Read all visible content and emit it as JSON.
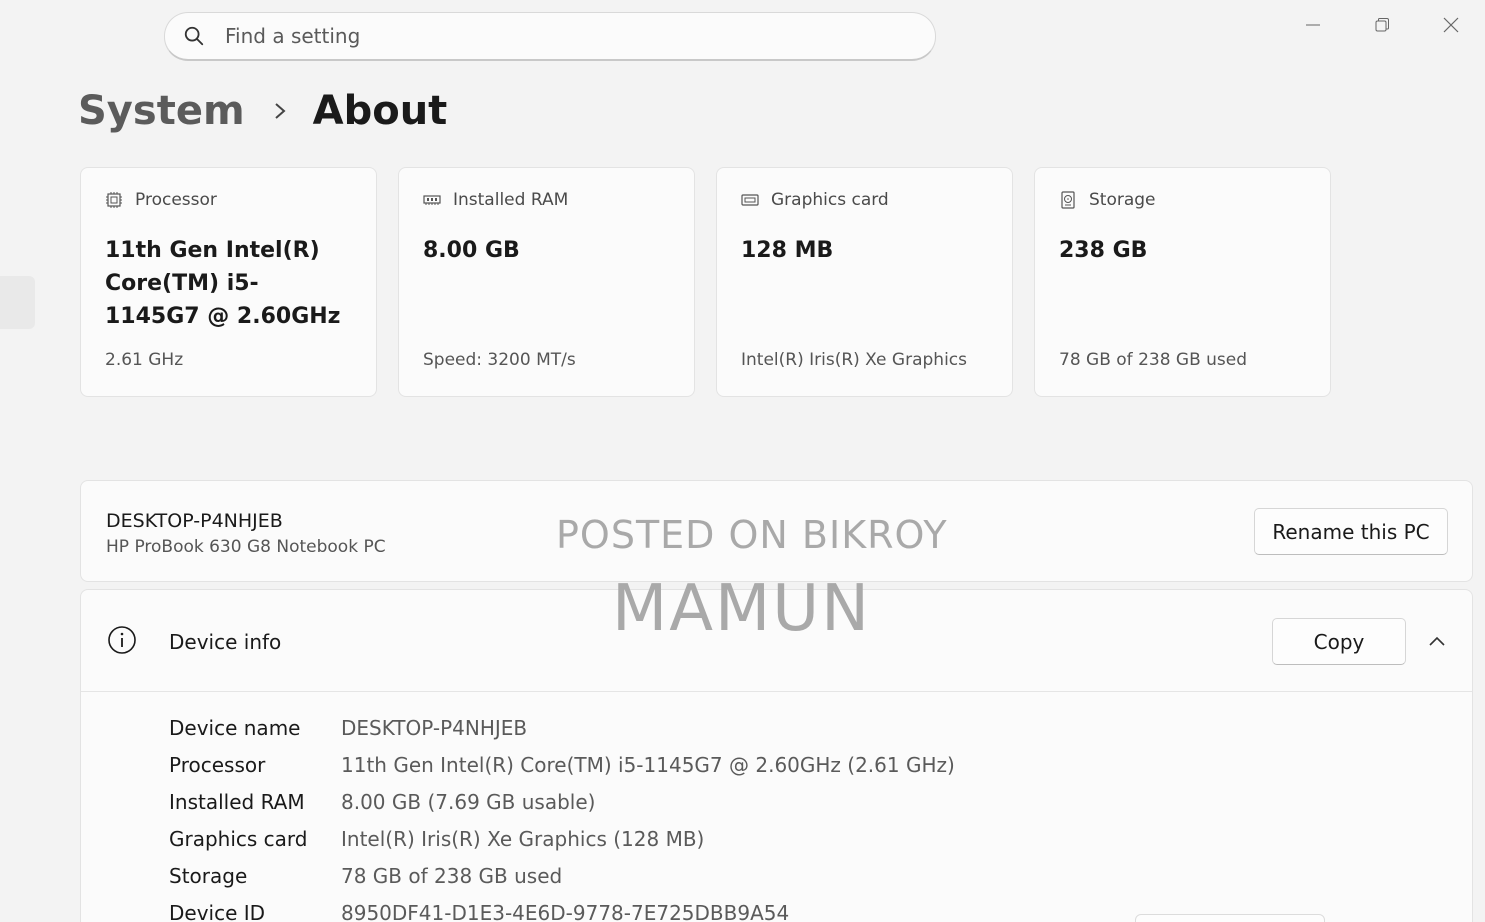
{
  "search": {
    "placeholder": "Find a setting"
  },
  "window_controls": [
    "minimize-icon",
    "restore-icon",
    "close-icon"
  ],
  "breadcrumb": {
    "parent": "System",
    "current": "About"
  },
  "specs": [
    {
      "icon": "processor-icon",
      "label": "Processor",
      "value": "11th Gen Intel(R) Core(TM) i5-1145G7 @ 2.60GHz",
      "detail": "2.61 GHz"
    },
    {
      "icon": "ram-icon",
      "label": "Installed RAM",
      "value": "8.00 GB",
      "detail": "Speed: 3200 MT/s"
    },
    {
      "icon": "graphics-card-icon",
      "label": "Graphics card",
      "value": "128 MB",
      "detail": "Intel(R) Iris(R) Xe Graphics"
    },
    {
      "icon": "storage-icon",
      "label": "Storage",
      "value": "238 GB",
      "detail": "78 GB of 238 GB used"
    }
  ],
  "pc": {
    "name": "DESKTOP-P4NHJEB",
    "model": "HP ProBook 630 G8 Notebook PC",
    "rename_label": "Rename this PC"
  },
  "watermark": {
    "line1": "POSTED ON BIKROY",
    "line2": "MAMUN"
  },
  "device_info": {
    "title": "Device info",
    "copy_label": "Copy",
    "rows": [
      {
        "label": "Device name",
        "value": "DESKTOP-P4NHJEB"
      },
      {
        "label": "Processor",
        "value": "11th Gen Intel(R) Core(TM) i5-1145G7 @ 2.60GHz (2.61 GHz)"
      },
      {
        "label": "Installed RAM",
        "value": "8.00 GB (7.69 GB usable)"
      },
      {
        "label": "Graphics card",
        "value": "Intel(R) Iris(R) Xe Graphics (128 MB)"
      },
      {
        "label": "Storage",
        "value": "78 GB of 238 GB used"
      },
      {
        "label": "Device ID",
        "value": "8950DF41-D1E3-4E6D-9778-7E725DBB9A54"
      }
    ]
  }
}
